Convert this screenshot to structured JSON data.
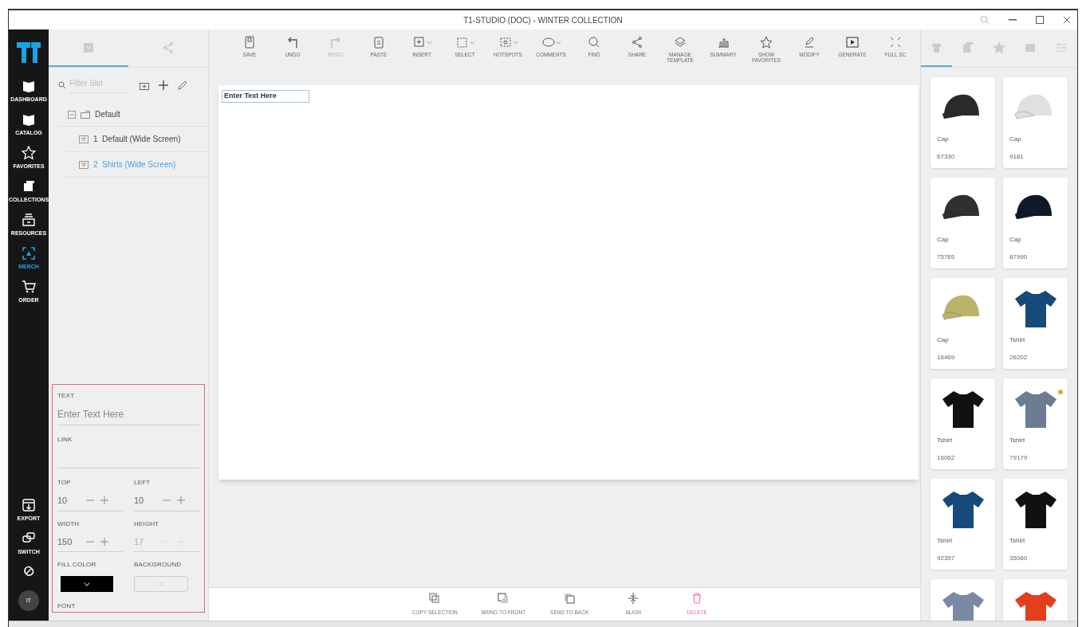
{
  "window": {
    "title": "T1-STUDIO (DOC) - WINTER COLLECTION"
  },
  "nav": [
    {
      "label": "DASHBOARD",
      "selected": false
    },
    {
      "label": "CATALOG",
      "selected": false
    },
    {
      "label": "FAVORITES",
      "selected": false
    },
    {
      "label": "COLLECTIONS",
      "selected": false
    },
    {
      "label": "RESOURCES",
      "selected": false
    },
    {
      "label": "MERCH",
      "selected": true
    },
    {
      "label": "ORDER",
      "selected": false
    }
  ],
  "nav_bottom": [
    {
      "label": "EXPORT"
    },
    {
      "label": "SWITCH"
    }
  ],
  "user_initials": "IT",
  "slides_panel": {
    "tabs": [
      {
        "selected": true
      },
      {
        "selected": false
      }
    ],
    "search": {
      "placeholder": "Filter Slid"
    },
    "tree": [
      {
        "label": "Default",
        "expanded": true,
        "children": [
          {
            "label": "1  Default (Wide Screen)",
            "selected": false
          },
          {
            "label": "2  Shirts (Wide Screen)",
            "selected": true
          }
        ]
      }
    ]
  },
  "toolbar": [
    {
      "label": "SAVE",
      "disabled": false,
      "dropdown": false
    },
    {
      "label": "UNDO",
      "disabled": false,
      "dropdown": false
    },
    {
      "label": "REDO",
      "disabled": true,
      "dropdown": false
    },
    {
      "label": "PASTE",
      "disabled": false,
      "dropdown": false
    },
    {
      "label": "INSERT",
      "disabled": false,
      "dropdown": true
    },
    {
      "label": "SELECT",
      "disabled": false,
      "dropdown": true
    },
    {
      "label": "HOTSPOTS",
      "disabled": false,
      "dropdown": true
    },
    {
      "label": "COMMENTS",
      "disabled": false,
      "dropdown": true
    },
    {
      "label": "FIND",
      "disabled": false,
      "dropdown": false
    },
    {
      "label": "SHARE",
      "disabled": false,
      "dropdown": false
    },
    {
      "label": "MANAGE TEMPLATE",
      "disabled": false,
      "dropdown": false
    },
    {
      "label": "SUMMARY",
      "disabled": false,
      "dropdown": false
    },
    {
      "label": "SHOW FAVORITES",
      "disabled": false,
      "dropdown": false
    },
    {
      "label": "MODIFY",
      "disabled": false,
      "dropdown": false
    },
    {
      "label": "GENERATE",
      "disabled": false,
      "dropdown": false
    },
    {
      "label": "FULL SC",
      "disabled": false,
      "dropdown": false
    }
  ],
  "canvas": {
    "text_element": "Enter Text Here"
  },
  "properties": {
    "text": {
      "label": "TEXT",
      "placeholder": "Enter Text Here"
    },
    "link": {
      "label": "LINK"
    },
    "numbers": [
      {
        "label": "TOP",
        "value": "10",
        "disabled": false
      },
      {
        "label": "LEFT",
        "value": "10",
        "disabled": false
      },
      {
        "label": "WIDTH",
        "value": "150",
        "disabled": false
      },
      {
        "label": "HEIGHT",
        "value": "17",
        "disabled": true
      }
    ],
    "fill_color": {
      "label": "FILL COLOR",
      "color": "#000000"
    },
    "background": {
      "label": "BACKGROUND"
    },
    "font": {
      "label": "FONT"
    }
  },
  "bottom_toolbar": [
    {
      "label": "COPY SELECTION",
      "kind": "normal"
    },
    {
      "label": "BRING TO FRONT",
      "kind": "normal"
    },
    {
      "label": "SEND TO BACK",
      "kind": "normal"
    },
    {
      "label": "ALIGN",
      "kind": "normal"
    },
    {
      "label": "DELETE",
      "kind": "danger"
    }
  ],
  "right_tabs": [
    {
      "selected": true
    },
    {
      "selected": false
    },
    {
      "selected": false
    },
    {
      "selected": false
    },
    {
      "selected": false
    }
  ],
  "products": [
    {
      "name": "Cap",
      "number": "67330",
      "kind": "cap",
      "color": "#2b2b2b",
      "flag": false
    },
    {
      "name": "Cap",
      "number": "9181",
      "kind": "cap",
      "color": "#e0e0e0",
      "flag": false
    },
    {
      "name": "Cap",
      "number": "75765",
      "kind": "cap",
      "color": "#303030",
      "flag": false
    },
    {
      "name": "Cap",
      "number": "87990",
      "kind": "cap",
      "color": "#111827",
      "flag": false
    },
    {
      "name": "Cap",
      "number": "16469",
      "kind": "cap",
      "color": "#b9b46a",
      "flag": false
    },
    {
      "name": "Tshirt",
      "number": "26202",
      "kind": "tshirt",
      "color": "#164a7a",
      "flag": false
    },
    {
      "name": "Tshirt",
      "number": "16062",
      "kind": "tshirt",
      "color": "#111111",
      "flag": false
    },
    {
      "name": "Tshirt",
      "number": "79179",
      "kind": "tshirt",
      "color": "#6b7c93",
      "flag": true
    },
    {
      "name": "Tshirt",
      "number": "92357",
      "kind": "tshirt",
      "color": "#164a7a",
      "flag": false
    },
    {
      "name": "Tshirt",
      "number": "35080",
      "kind": "tshirt",
      "color": "#111111",
      "flag": false
    },
    {
      "kind": "tshirt",
      "color": "#7b8aa3",
      "flag": false
    },
    {
      "kind": "tshirt",
      "color": "#e2401c",
      "flag": false
    }
  ]
}
